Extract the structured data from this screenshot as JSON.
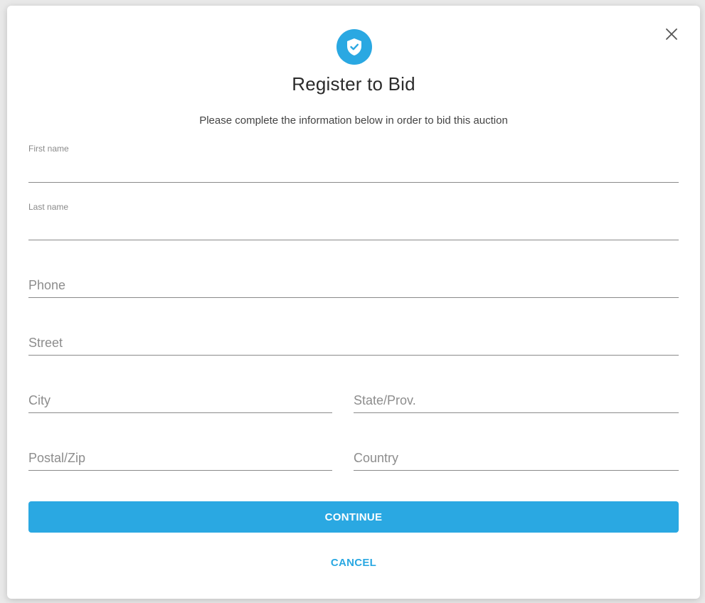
{
  "colors": {
    "accent": "#2aa8e2",
    "text": "#2b2b2b",
    "muted": "#8d8d8d"
  },
  "header": {
    "icon": "shield-check-icon",
    "title": "Register to Bid",
    "subtitle": "Please complete the information below in order to bid this auction"
  },
  "form": {
    "first_name": {
      "label": "First name",
      "value": ""
    },
    "last_name": {
      "label": "Last name",
      "value": ""
    },
    "phone": {
      "placeholder": "Phone"
    },
    "street": {
      "placeholder": "Street"
    },
    "city": {
      "placeholder": "City"
    },
    "state": {
      "placeholder": "State/Prov."
    },
    "postal": {
      "placeholder": "Postal/Zip"
    },
    "country": {
      "placeholder": "Country"
    }
  },
  "actions": {
    "continue_label": "CONTINUE",
    "cancel_label": "CANCEL",
    "close_icon": "close-icon"
  }
}
